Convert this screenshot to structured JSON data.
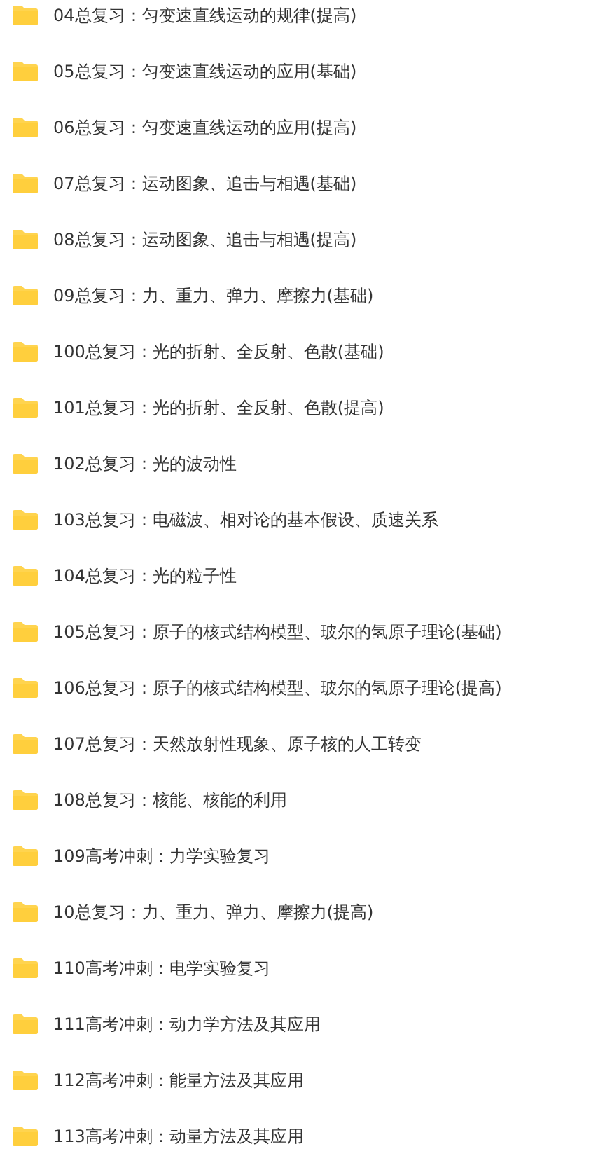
{
  "folders": [
    {
      "name": "04总复习：匀变速直线运动的规律(提高)"
    },
    {
      "name": "05总复习：匀变速直线运动的应用(基础)"
    },
    {
      "name": "06总复习：匀变速直线运动的应用(提高)"
    },
    {
      "name": "07总复习：运动图象、追击与相遇(基础)"
    },
    {
      "name": "08总复习：运动图象、追击与相遇(提高)"
    },
    {
      "name": "09总复习：力、重力、弹力、摩擦力(基础)"
    },
    {
      "name": "100总复习：光的折射、全反射、色散(基础)"
    },
    {
      "name": "101总复习：光的折射、全反射、色散(提高)"
    },
    {
      "name": "102总复习：光的波动性"
    },
    {
      "name": "103总复习：电磁波、相对论的基本假设、质速关系"
    },
    {
      "name": "104总复习：光的粒子性"
    },
    {
      "name": "105总复习：原子的核式结构模型、玻尔的氢原子理论(基础)"
    },
    {
      "name": "106总复习：原子的核式结构模型、玻尔的氢原子理论(提高)"
    },
    {
      "name": "107总复习：天然放射性现象、原子核的人工转变"
    },
    {
      "name": "108总复习：核能、核能的利用"
    },
    {
      "name": "109高考冲刺：力学实验复习"
    },
    {
      "name": "10总复习：力、重力、弹力、摩擦力(提高)"
    },
    {
      "name": "110高考冲刺：电学实验复习"
    },
    {
      "name": "111高考冲刺：动力学方法及其应用"
    },
    {
      "name": "112高考冲刺：能量方法及其应用"
    },
    {
      "name": "113高考冲刺：动量方法及其应用"
    }
  ]
}
